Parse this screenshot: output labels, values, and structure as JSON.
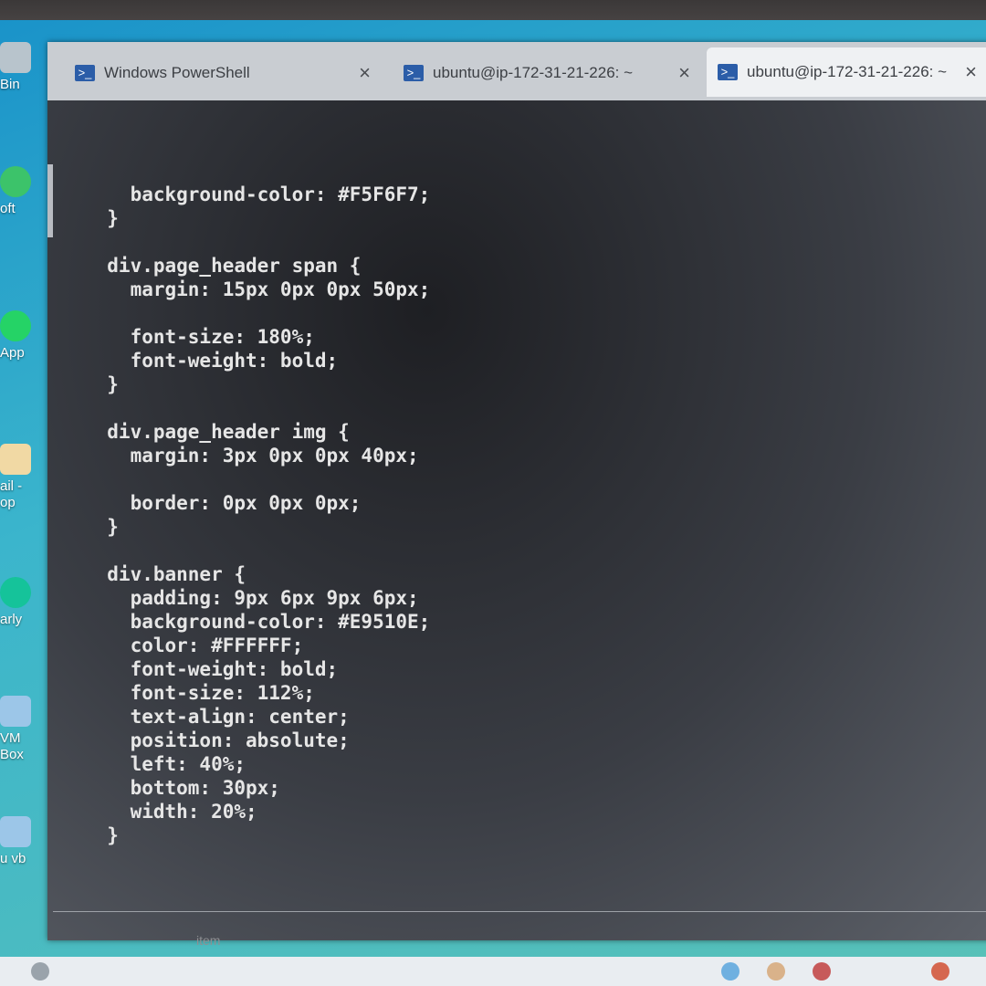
{
  "desktop": {
    "icons": [
      {
        "label": "Bin",
        "name": "recycle-bin-icon"
      },
      {
        "label": "oft",
        "name": "microsoft-edge-icon"
      },
      {
        "label": "App",
        "name": "whatsapp-icon"
      },
      {
        "label": "ail -\nop",
        "name": "mail-app-icon"
      },
      {
        "label": "arly",
        "name": "grammarly-icon"
      },
      {
        "label": "VM\nBox",
        "name": "virtualbox-icon"
      },
      {
        "label": "u vb",
        "name": "ubuntu-vb-icon"
      }
    ]
  },
  "window": {
    "tabs": [
      {
        "label": "Windows PowerShell",
        "close": "×"
      },
      {
        "label": "ubuntu@ip-172-31-21-226: ~",
        "close": "×"
      },
      {
        "label": "ubuntu@ip-172-31-21-226: ~",
        "close": "×"
      }
    ]
  },
  "terminal": {
    "lines": [
      "    background-color: #F5F6F7;",
      "  }",
      "",
      "  div.page_header span {",
      "    margin: 15px 0px 0px 50px;",
      "",
      "    font-size: 180%;",
      "    font-weight: bold;",
      "  }",
      "",
      "  div.page_header img {",
      "    margin: 3px 0px 0px 40px;",
      "",
      "    border: 0px 0px 0px;",
      "  }",
      "",
      "  div.banner {",
      "    padding: 9px 6px 9px 6px;",
      "    background-color: #E9510E;",
      "    color: #FFFFFF;",
      "    font-weight: bold;",
      "    font-size: 112%;",
      "    text-align: center;",
      "    position: absolute;",
      "    left: 40%;",
      "    bottom: 30px;",
      "    width: 20%;",
      "  }"
    ]
  },
  "taskbar": {
    "faint_label": "item"
  },
  "colors": {
    "tab_icon": "#2b5da8",
    "terminal_text": "#e6e6e6",
    "desktop": "#1a93c9"
  }
}
